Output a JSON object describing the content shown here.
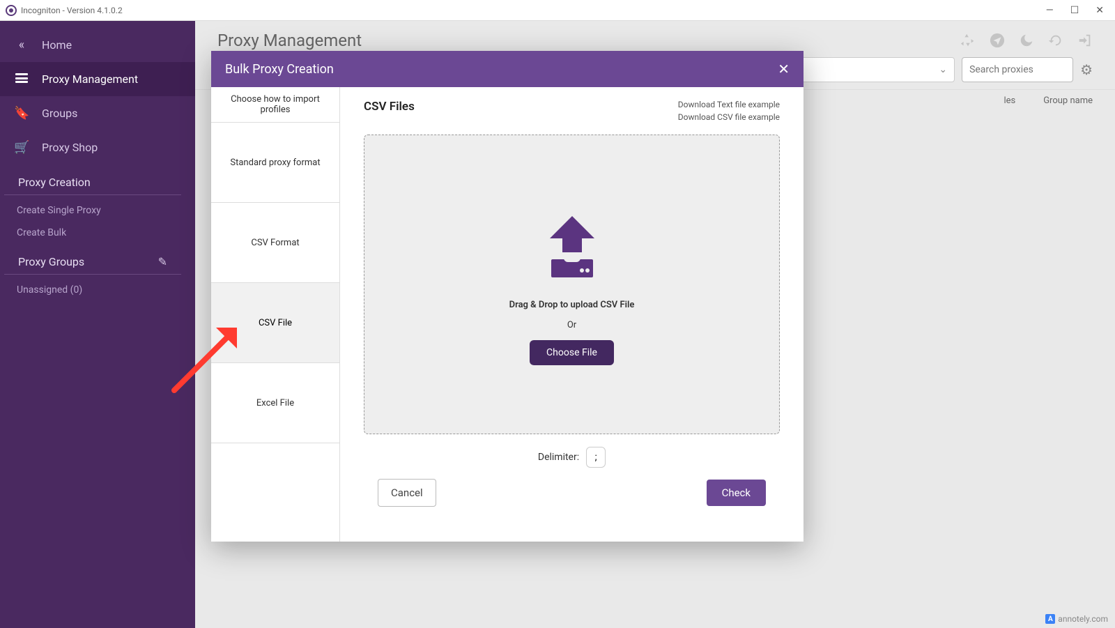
{
  "window": {
    "title": "Incogniton - Version 4.1.0.2"
  },
  "sidebar": {
    "items": [
      {
        "label": "Home",
        "icon": "chevrons-left"
      },
      {
        "label": "Proxy Management",
        "icon": "bars"
      },
      {
        "label": "Groups",
        "icon": "bookmark"
      },
      {
        "label": "Proxy Shop",
        "icon": "cart"
      }
    ],
    "proxy_creation": {
      "header": "Proxy Creation",
      "links": [
        "Create Single Proxy",
        "Create Bulk"
      ]
    },
    "proxy_groups": {
      "header": "Proxy Groups",
      "links": [
        "Unassigned (0)"
      ]
    }
  },
  "main": {
    "title": "Proxy Management",
    "search_placeholder": "Search proxies",
    "columns": [
      "les",
      "Group name"
    ]
  },
  "modal": {
    "title": "Bulk Proxy Creation",
    "import_header": "Choose how to import profiles",
    "tabs": [
      "Standard proxy format",
      "CSV Format",
      "CSV File",
      "Excel File"
    ],
    "active_tab": 2,
    "content": {
      "heading": "CSV Files",
      "download_text": "Download Text file example",
      "download_csv": "Download CSV file example",
      "drag_text": "Drag & Drop to upload CSV File",
      "or_text": "Or",
      "choose_file": "Choose File",
      "delimiter_label": "Delimiter:",
      "delimiter_value": ";"
    },
    "footer": {
      "cancel": "Cancel",
      "check": "Check"
    }
  },
  "watermark": "annotely.com"
}
